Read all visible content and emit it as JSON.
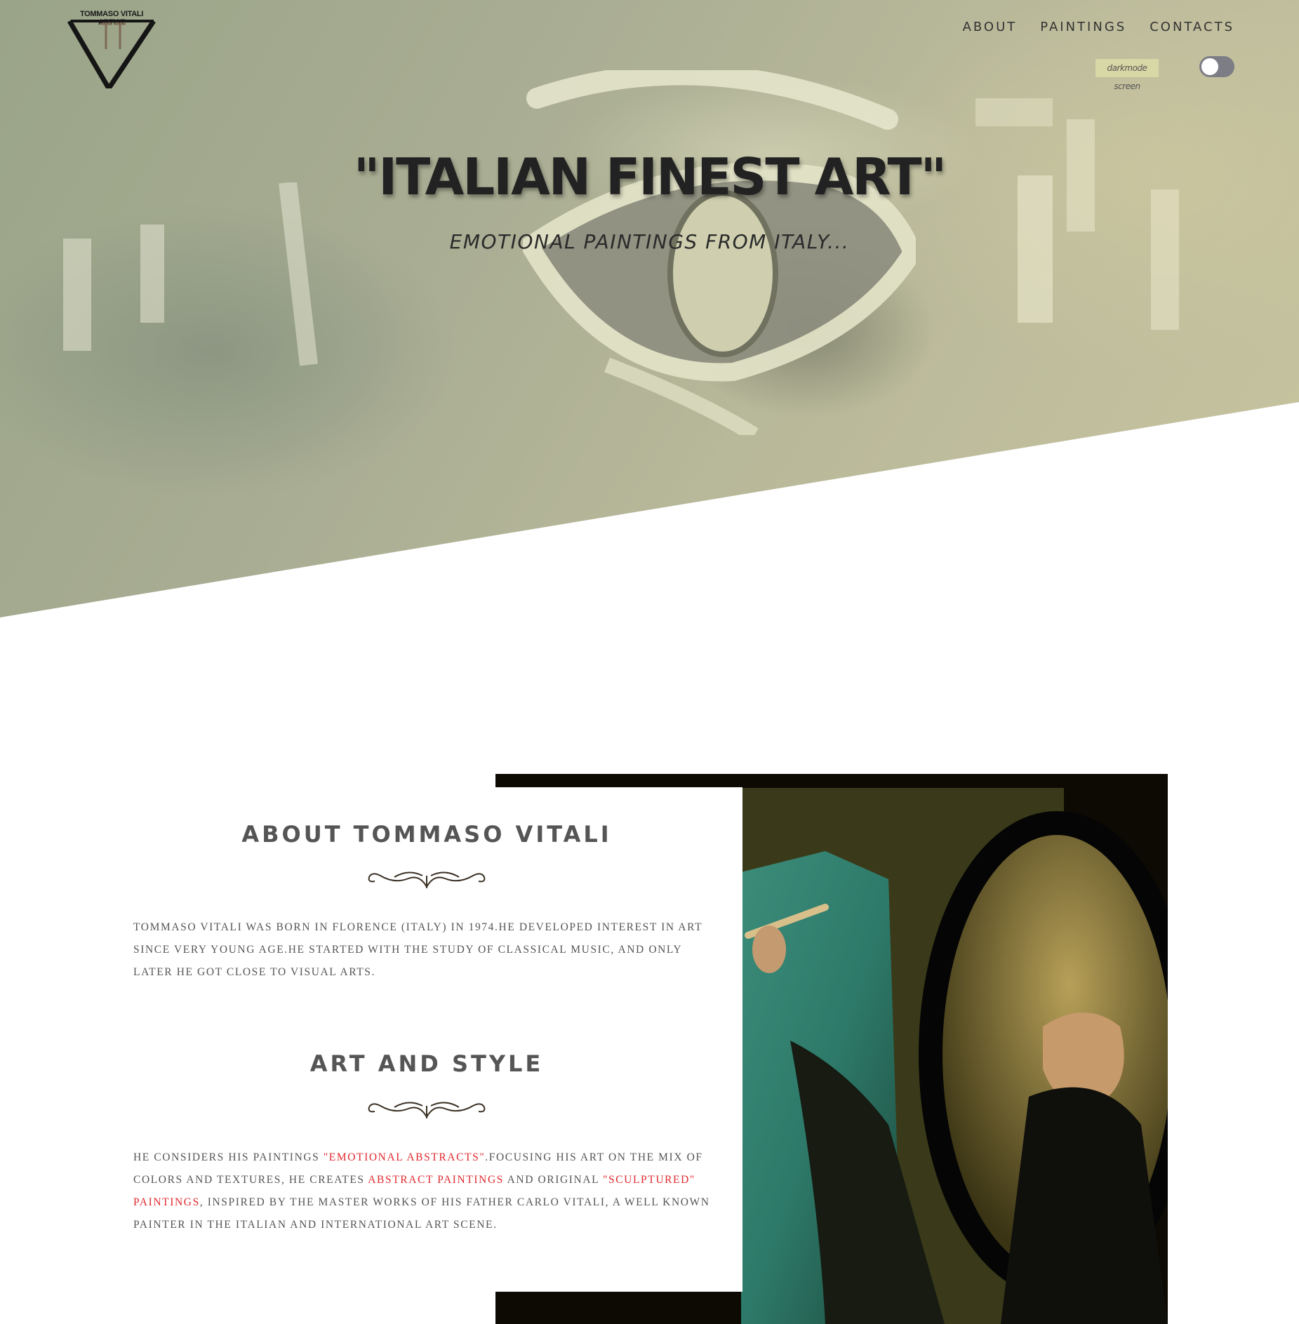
{
  "logo": {
    "text": "TOMMASO VITALI ARTIST"
  },
  "nav": {
    "items": [
      "ABOUT",
      "PAINTINGS",
      "CONTACTS"
    ]
  },
  "darkmode": {
    "label": "darkmode screen",
    "state": "off"
  },
  "hero": {
    "title": "\"ITALIAN FINEST ART\"",
    "subtitle": "EMOTIONAL PAINTINGS FROM ITALY..."
  },
  "about": {
    "title": "ABOUT TOMMASO VITALI",
    "text": "TOMMASO VITALI WAS BORN IN FLORENCE (ITALY) IN 1974.HE DEVELOPED INTEREST IN ART SINCE VERY YOUNG AGE.HE STARTED WITH THE STUDY OF CLASSICAL MUSIC, AND ONLY LATER HE GOT CLOSE TO VISUAL ARTS."
  },
  "style": {
    "title": "ART AND STYLE",
    "p1": "HE CONSIDERS HIS PAINTINGS ",
    "link1": "\"EMOTIONAL ABSTRACTS\"",
    "p2": ".FOCUSING HIS ART ON THE MIX OF COLORS AND TEXTURES, HE CREATES ",
    "link2": "ABSTRACT PAINTINGS",
    "p3": " AND ORIGINAL ",
    "link3": "\"SCULPTURED\" PAINTINGS",
    "p4": ", INSPIRED BY THE MASTER WORKS OF HIS FATHER CARLO VITALI, A WELL KNOWN PAINTER IN THE ITALIAN AND INTERNATIONAL ART SCENE."
  },
  "colors": {
    "link": "#e0282e",
    "toggle": "#7d7d86",
    "darkmode_bg": "#d8d7a6"
  }
}
